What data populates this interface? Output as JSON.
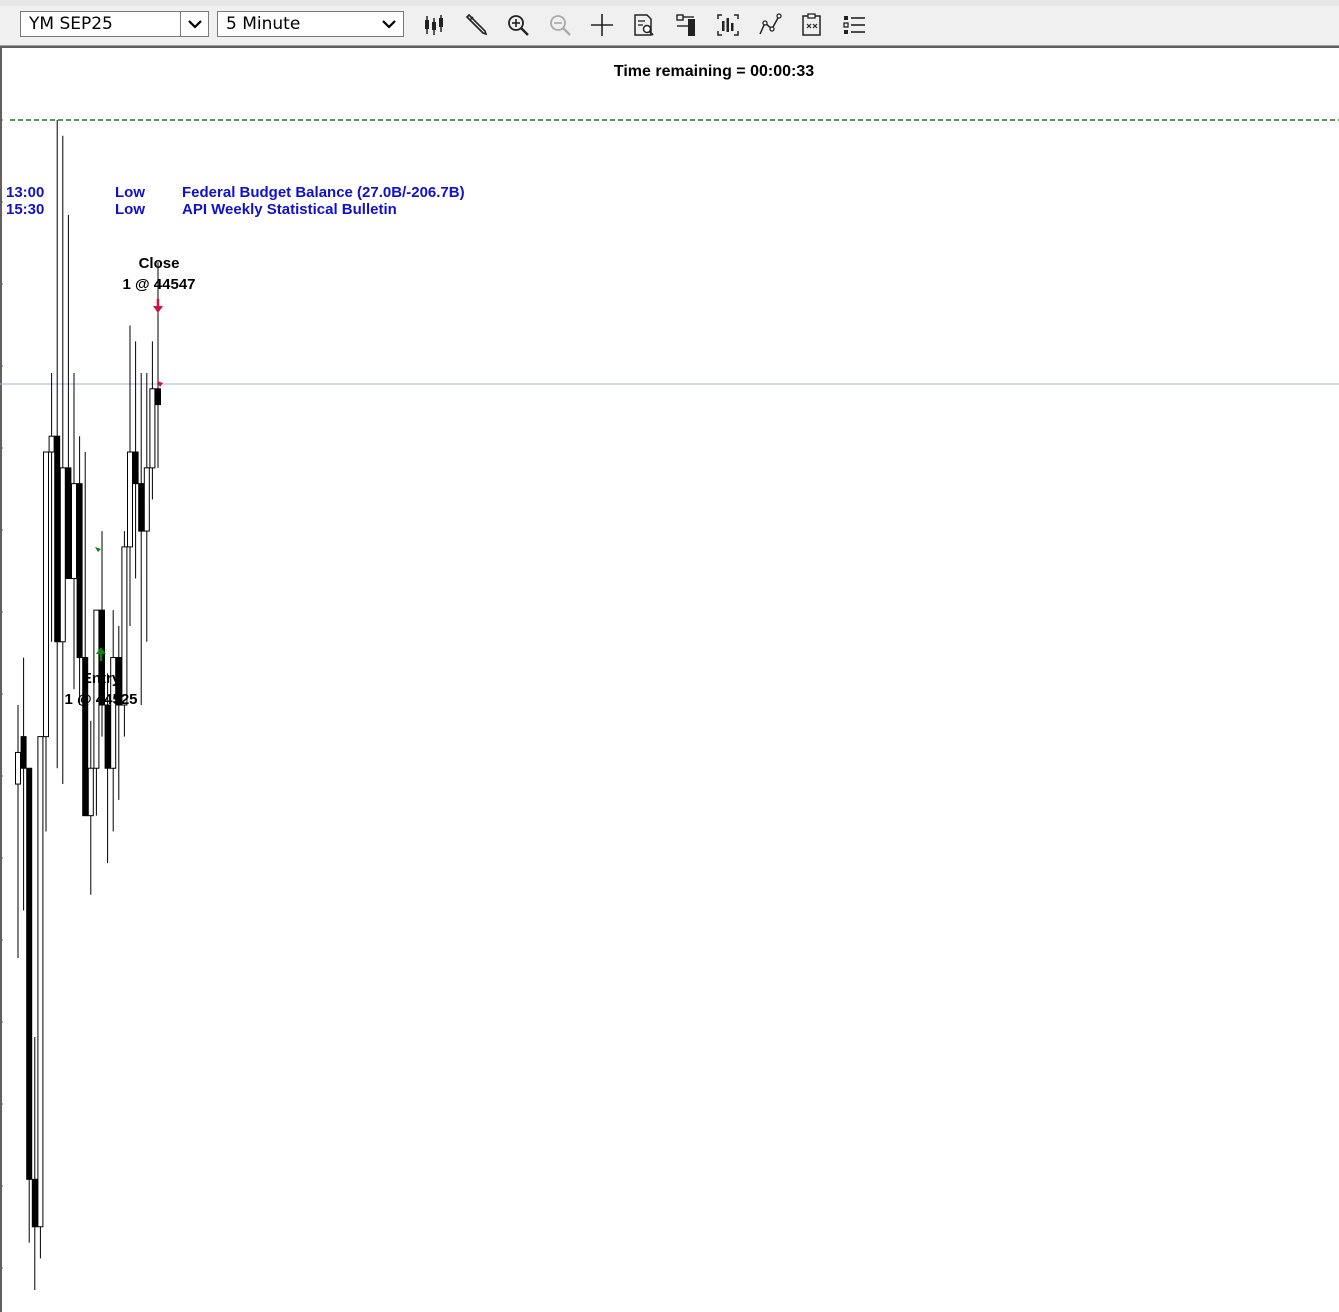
{
  "toolbar": {
    "instrument": "YM SEP25",
    "interval": "5 Minute",
    "icons": [
      "chart-style-icon",
      "draw-tool-icon",
      "zoom-in-icon",
      "zoom-out-icon",
      "crosshair-icon",
      "properties-icon",
      "data-box-icon",
      "bar-spacing-icon",
      "strategy-icon",
      "templates-icon",
      "list-icon"
    ]
  },
  "chart": {
    "time_remaining": "Time remaining = 00:00:33",
    "events": [
      {
        "time": "13:00",
        "impact": "Low",
        "title": "Federal Budget Balance (27.0B/-206.7B)"
      },
      {
        "time": "15:30",
        "impact": "Low",
        "title": "API Weekly Statistical Bulletin"
      }
    ],
    "close_marker": {
      "title": "Close",
      "detail": "1 @ 44547"
    },
    "entry_marker": {
      "title": "Entry",
      "detail": "1 @ 44525"
    },
    "colors": {
      "event_text": "#1010d0",
      "sell_arrow": "#d01040",
      "buy_arrow": "#108010",
      "dashed_line": "#1a7a1a",
      "price_line": "#a0b4d8"
    }
  },
  "chart_data": {
    "type": "candlestick",
    "candles": [
      {
        "o": 44511,
        "h": 44516,
        "l": 44500,
        "c": 44513
      },
      {
        "o": 44514,
        "h": 44519,
        "l": 44503,
        "c": 44512
      },
      {
        "o": 44512,
        "h": 44512,
        "l": 44482,
        "c": 44486
      },
      {
        "o": 44486,
        "h": 44495,
        "l": 44479,
        "c": 44483
      },
      {
        "o": 44483,
        "h": 44498,
        "l": 44481,
        "c": 44514
      },
      {
        "o": 44514,
        "h": 44530,
        "l": 44508,
        "c": 44532
      },
      {
        "o": 44532,
        "h": 44537,
        "l": 44520,
        "c": 44533
      },
      {
        "o": 44533,
        "h": 44553,
        "l": 44512,
        "c": 44520
      },
      {
        "o": 44520,
        "h": 44552,
        "l": 44511,
        "c": 44531
      },
      {
        "o": 44531,
        "h": 44547,
        "l": 44528,
        "c": 44524
      },
      {
        "o": 44524,
        "h": 44537,
        "l": 44517,
        "c": 44530
      },
      {
        "o": 44530,
        "h": 44533,
        "l": 44516,
        "c": 44519
      },
      {
        "o": 44519,
        "h": 44532,
        "l": 44512,
        "c": 44509
      },
      {
        "o": 44509,
        "h": 44515,
        "l": 44504,
        "c": 44512
      },
      {
        "o": 44512,
        "h": 44520,
        "l": 44509,
        "c": 44522
      },
      {
        "o": 44522,
        "h": 44527,
        "l": 44514,
        "c": 44516
      },
      {
        "o": 44516,
        "h": 44518,
        "l": 44506,
        "c": 44512
      },
      {
        "o": 44512,
        "h": 44522,
        "l": 44508,
        "c": 44519
      },
      {
        "o": 44519,
        "h": 44521,
        "l": 44510,
        "c": 44516
      },
      {
        "o": 44516,
        "h": 44527,
        "l": 44514,
        "c": 44526
      },
      {
        "o": 44526,
        "h": 44540,
        "l": 44521,
        "c": 44532
      },
      {
        "o": 44532,
        "h": 44539,
        "l": 44524,
        "c": 44530
      },
      {
        "o": 44530,
        "h": 44537,
        "l": 44516,
        "c": 44527
      },
      {
        "o": 44527,
        "h": 44537,
        "l": 44520,
        "c": 44531
      },
      {
        "o": 44531,
        "h": 44539,
        "l": 44529,
        "c": 44536
      },
      {
        "o": 44536,
        "h": 44544,
        "l": 44531,
        "c": 44535
      }
    ]
  }
}
